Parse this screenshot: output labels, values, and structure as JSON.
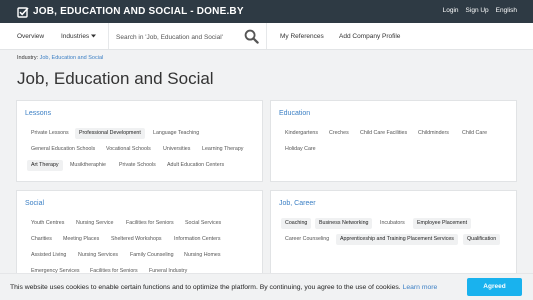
{
  "header": {
    "title": "JOB, EDUCATION AND SOCIAL - DONE.BY",
    "icon": "checkbox-icon",
    "links": [
      "Login",
      "Sign Up",
      "English"
    ]
  },
  "nav": {
    "overview": "Overview",
    "industries": "Industries",
    "search_placeholder": "Search in 'Job, Education and Social'",
    "my_references": "My References",
    "add_company": "Add Company Profile"
  },
  "breadcrumb": {
    "label": "Industry:",
    "link": "Job, Education and Social"
  },
  "page_title": "Job, Education and Social",
  "sections": {
    "lessons": {
      "title": "Lessons",
      "tags": [
        "Private Lessons",
        "Professional Development",
        "Language Teaching",
        "General Education Schools",
        "Vocational Schools",
        "Universities",
        "Learning Therapy",
        "Art Therapy",
        "Musiktheraphie",
        "Private Schools",
        "Adult Education Centers"
      ]
    },
    "education": {
      "title": "Education",
      "tags": [
        "Kindergartens",
        "Creches",
        "Child Care Facilities",
        "Childminders",
        "Child Care",
        "Holiday Care"
      ]
    },
    "social": {
      "title": "Social",
      "tags": [
        "Youth Centres",
        "Nursing Service",
        "Facilities for Seniors",
        "Social Services",
        "Charities",
        "Meeting Places",
        "Sheltered Workshops",
        "Information Centers",
        "Assisted Living",
        "Nursing Services",
        "Family Counseling",
        "Nursing Homes",
        "Emergency Services",
        "Facilities for Seniors",
        "Funeral Industry"
      ]
    },
    "job_career": {
      "title": "Job, Career",
      "tags": [
        "Coaching",
        "Business Networking",
        "Incubators",
        "Employee Placement",
        "Career Counseling",
        "Apprenticeship and Training Placement Services",
        "Qualification"
      ]
    }
  },
  "cookie": {
    "text": "This website uses cookies to enable certain functions and to optimize the platform. By continuing, you agree to the use of cookies.",
    "learn_more": "Learn more",
    "accept": "Agreed"
  },
  "colors": {
    "header_bg": "#2e3a44",
    "link": "#3b7fc4",
    "accept_bg": "#19b2ee"
  }
}
